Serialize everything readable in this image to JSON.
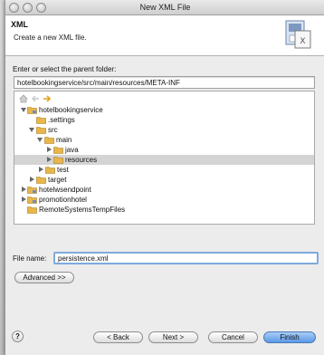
{
  "window": {
    "title": "New XML File"
  },
  "banner": {
    "title": "XML",
    "description": "Create a new XML file."
  },
  "parent_folder": {
    "label": "Enter or select the parent folder:",
    "value": "hotelbookingservice/src/main/resources/META-INF"
  },
  "tree": {
    "items": [
      {
        "label": "hotelbookingservice",
        "state": "open"
      },
      {
        "label": ".settings",
        "state": "leaf"
      },
      {
        "label": "src",
        "state": "open"
      },
      {
        "label": "main",
        "state": "open"
      },
      {
        "label": "java",
        "state": "closed"
      },
      {
        "label": "resources",
        "state": "closed",
        "selected": true
      },
      {
        "label": "test",
        "state": "closed"
      },
      {
        "label": "target",
        "state": "closed"
      },
      {
        "label": "hotelwsendpoint",
        "state": "closed"
      },
      {
        "label": "promotionhotel",
        "state": "closed"
      },
      {
        "label": "RemoteSystemsTempFiles",
        "state": "leaf"
      }
    ]
  },
  "file_name": {
    "label": "File name:",
    "value": "persistence.xml"
  },
  "buttons": {
    "advanced": "Advanced >>",
    "back": "< Back",
    "next": "Next >",
    "cancel": "Cancel",
    "finish": "Finish"
  },
  "help": "?",
  "colors": {
    "default_button": "#5b98e6",
    "focus_ring": "#7fa9dd",
    "folder": "#e8b64a"
  }
}
